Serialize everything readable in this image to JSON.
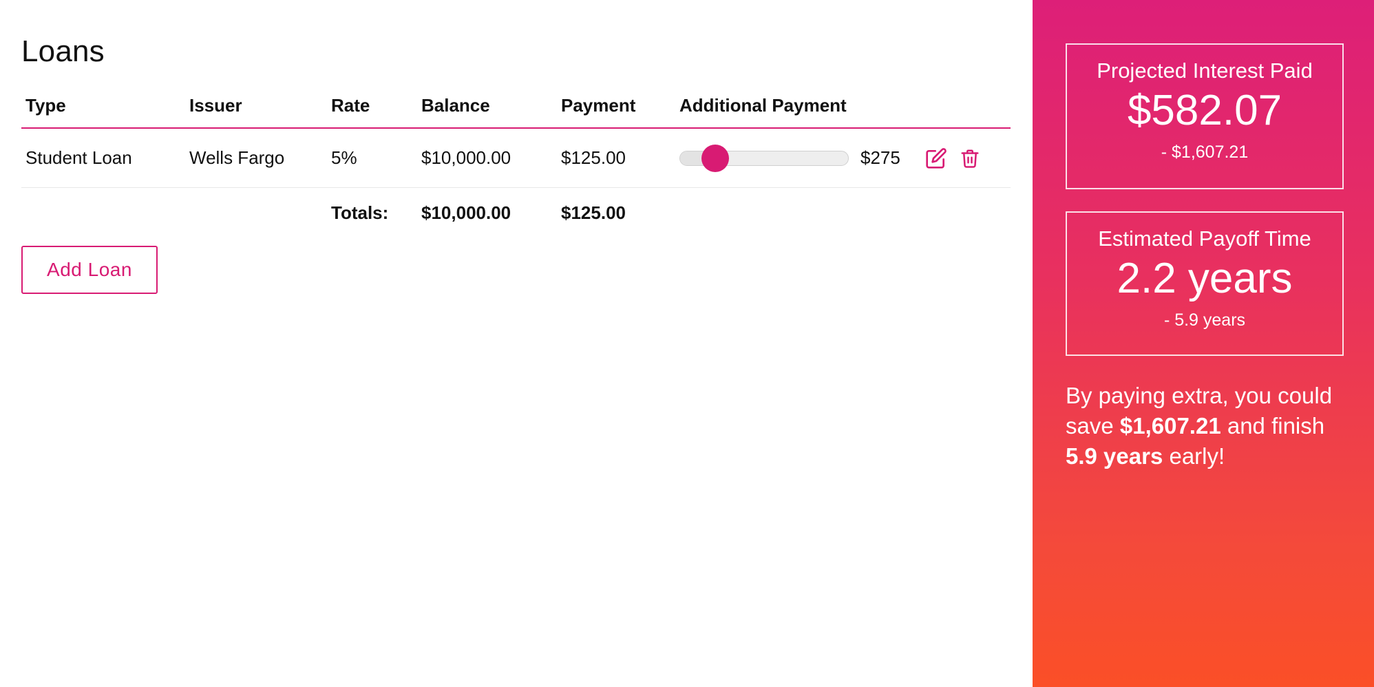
{
  "page": {
    "title": "Loans"
  },
  "table": {
    "headers": {
      "type": "Type",
      "issuer": "Issuer",
      "rate": "Rate",
      "balance": "Balance",
      "payment": "Payment",
      "additional": "Additional Payment"
    },
    "rows": [
      {
        "type": "Student Loan",
        "issuer": "Wells Fargo",
        "rate": "5%",
        "balance": "$10,000.00",
        "payment": "$125.00",
        "additional_slider_fraction": 0.21,
        "additional_value": "$275"
      }
    ],
    "totals": {
      "label": "Totals:",
      "balance": "$10,000.00",
      "payment": "$125.00"
    }
  },
  "actions": {
    "add_loan_label": "Add Loan"
  },
  "sidebar": {
    "interest": {
      "label": "Projected Interest Paid",
      "value": "$582.07",
      "delta": "- $1,607.21"
    },
    "payoff": {
      "label": "Estimated Payoff Time",
      "value": "2.2 years",
      "delta": "- 5.9 years"
    },
    "summary": {
      "prefix": "By paying extra, you could save ",
      "save_amount": "$1,607.21",
      "middle": " and finish ",
      "years_early": "5.9 years",
      "suffix": " early!"
    }
  },
  "colors": {
    "accent": "#d81b73",
    "sidebar_top": "#dd1f78",
    "sidebar_bottom": "#fb4f27"
  },
  "icons": {
    "edit": "edit-icon",
    "delete": "trash-icon"
  }
}
